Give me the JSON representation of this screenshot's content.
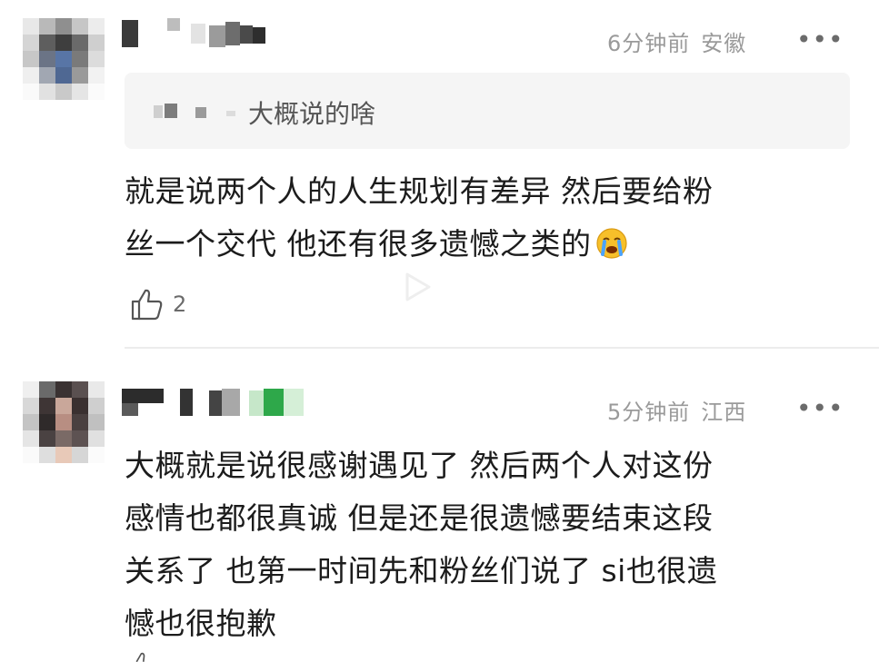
{
  "comments": [
    {
      "time": "6分钟前",
      "location": "安徽",
      "more": "•••",
      "reply_quote": "大概说的啥",
      "text_lines": [
        "就是说两个人的人生规划有差异 然后要给粉",
        "丝一个交代 他还有很多遗憾之类的"
      ],
      "emoji": "crying-face",
      "likes": "2"
    },
    {
      "time": "5分钟前",
      "location": "江西",
      "more": "•••",
      "text_lines": [
        "大概就是说很感谢遇见了 然后两个人对这份",
        "感情也都很真诚 但是还是很遗憾要结束这段",
        "关系了 也第一时间先和粉丝们说了 si也很遗",
        "憾也很抱歉"
      ]
    }
  ],
  "icons": {
    "like": "thumbs-up-icon",
    "more": "more-options-icon",
    "play": "play-icon"
  },
  "colors": {
    "meta": "#9a9a9a",
    "text": "#1c1c1c",
    "quote_bg": "#f5f5f5"
  }
}
